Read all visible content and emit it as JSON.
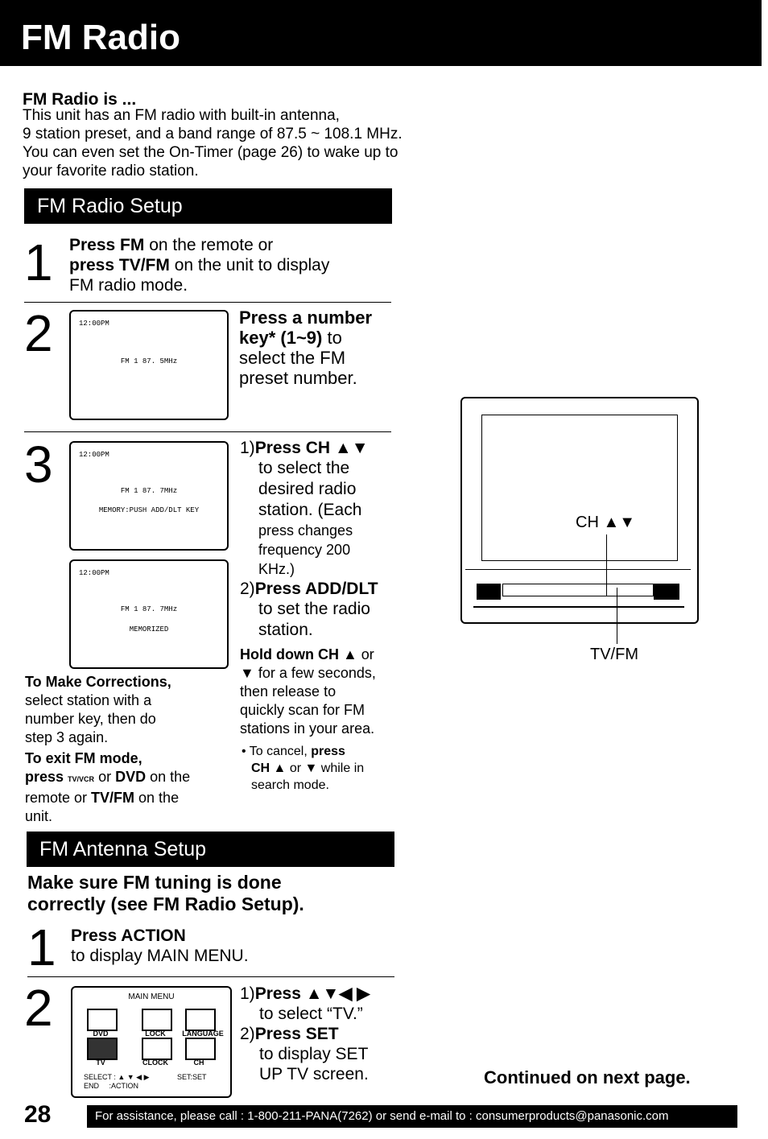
{
  "title": "FM Radio",
  "intro": {
    "heading": "FM Radio is ...",
    "lines": [
      "This unit has an FM radio with built-in antenna,",
      "9 station preset, and a band range of 87.5 ~ 108.1 MHz.",
      "You can even set the On-Timer (page 26) to wake up to",
      "your favorite radio station."
    ]
  },
  "setup": {
    "title": "FM Radio Setup",
    "step1": {
      "num": "1",
      "b1": "Press FM",
      "t1": " on the remote or",
      "b2": "press TV/FM",
      "t2": " on the unit to display",
      "t3": "FM radio mode."
    },
    "step2": {
      "num": "2",
      "screen": {
        "time": "12:00PM",
        "line": "FM 1   87. 5MHz"
      },
      "lines": [
        "Press a number",
        "key* (1~9)",
        " to",
        "select the FM",
        "preset number."
      ]
    },
    "step3": {
      "num": "3",
      "screen1": {
        "time": "12:00PM",
        "line": "FM 1   87. 7MHz",
        "msg": "MEMORY:PUSH  ADD/DLT KEY"
      },
      "screen2": {
        "time": "12:00PM",
        "line": "FM 1   87. 7MHz",
        "msg": "MEMORIZED"
      },
      "i1_num": "1)",
      "i1_bold": "Press CH ▲▼",
      "i1_lines": [
        "to select the",
        "desired radio",
        "station. (Each"
      ],
      "i1_small": [
        "press changes",
        "frequency 200",
        "KHz.)"
      ],
      "i2_num": "2)",
      "i2_bold": "Press ADD/DLT",
      "i2_lines": [
        "to set the radio",
        "station."
      ],
      "hold_bold": "Hold down CH ▲",
      "hold_lines": [
        " or",
        "▼ for a few seconds,",
        "then release to",
        "quickly scan for FM",
        "stations in your area."
      ],
      "cancel": {
        "t1": "• To cancel, ",
        "b1": "press",
        "b2": "CH ▲",
        "t2": " or ▼ while in",
        "t3": "search mode."
      }
    },
    "corrections": {
      "heading": "To Make Corrections,",
      "lines": [
        "select station with a",
        "number key, then do",
        "step 3 again."
      ]
    },
    "exit": {
      "heading": "To exit FM mode,",
      "b1": "press ",
      "vcr": "TV/VCR",
      "t1": " or ",
      "b2": "DVD",
      "t2": " on the",
      "t3": "remote or ",
      "b3": "TV/FM",
      "t4": " on the",
      "t5": "unit."
    }
  },
  "tv": {
    "ch_label": "CH ▲▼",
    "tvfm_label": "TV/FM"
  },
  "antenna": {
    "title": "FM Antenna Setup",
    "heading": [
      "Make sure FM tuning is done",
      "correctly (see FM Radio Setup)."
    ],
    "step1": {
      "num": "1",
      "bold": "Press ACTION",
      "text": "to display MAIN MENU."
    },
    "step2": {
      "num": "2",
      "menu": {
        "title": "MAIN MENU",
        "items": [
          "DVD",
          "LOCK",
          "LANGUAGE",
          "TV",
          "CLOCK",
          "CH"
        ],
        "select": "SELECT : ▲ ▼ ◀ ▶",
        "set": "SET:SET",
        "end": "END     :ACTION"
      },
      "i1_num": "1)",
      "i1_bold": "Press ▲▼◀ ▶",
      "i1_text": "to select “TV.”",
      "i2_num": "2)",
      "i2_bold": "Press SET",
      "i2_lines": [
        "to display SET",
        "UP TV screen."
      ]
    }
  },
  "continued": "Continued on next page.",
  "page_number": "28",
  "footer": "For assistance, please call : 1-800-211-PANA(7262) or send e-mail to : consumerproducts@panasonic.com"
}
